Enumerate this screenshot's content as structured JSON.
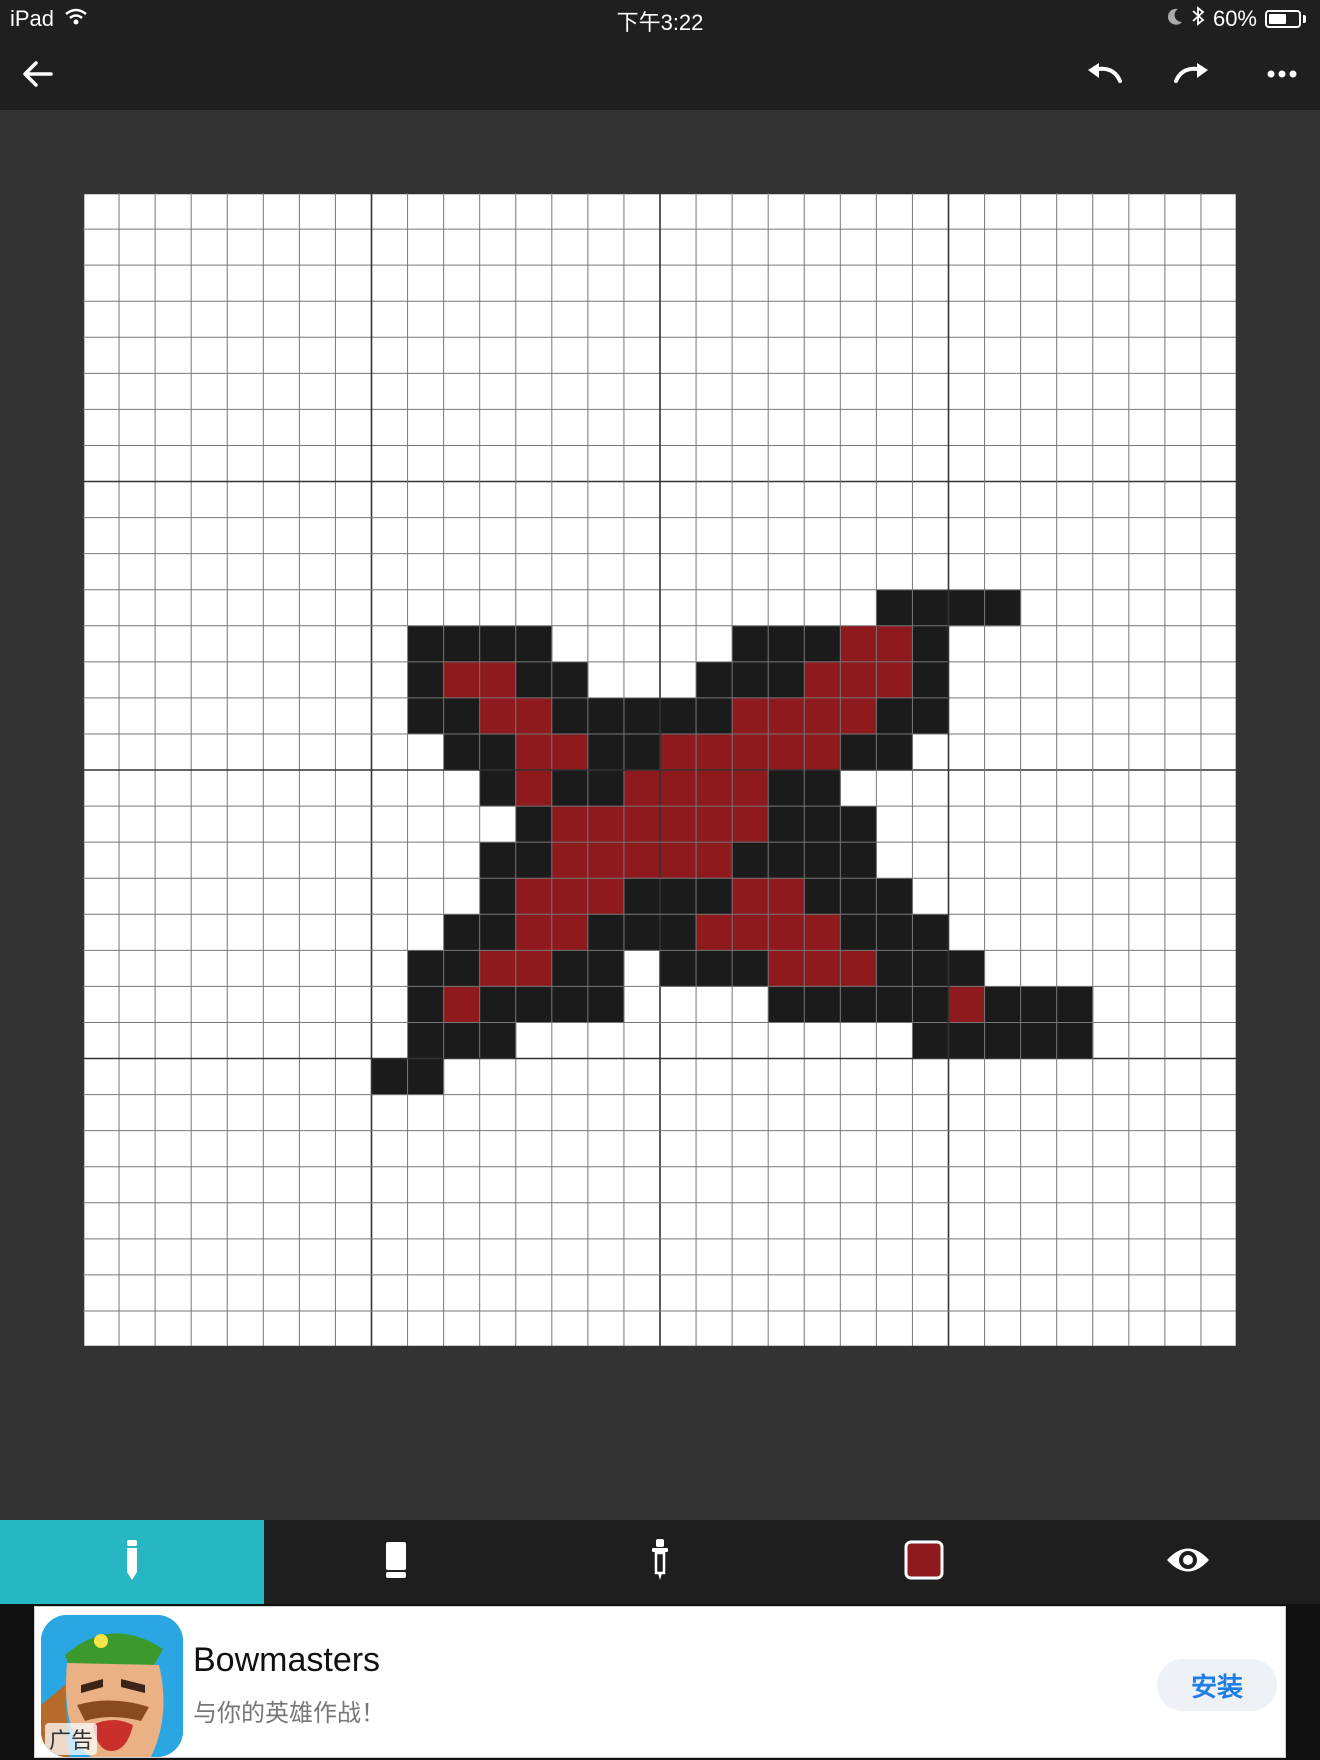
{
  "status": {
    "device": "iPad",
    "time": "下午3:22",
    "battery_text": "60%",
    "battery_level": 0.6,
    "icons": [
      "wifi-icon",
      "moon-icon",
      "bluetooth-icon",
      "battery-icon"
    ]
  },
  "toolbar": {
    "buttons": [
      "back-arrow-icon",
      "undo-icon",
      "redo-icon",
      "more-dots-icon"
    ]
  },
  "canvas": {
    "cols": 32,
    "rows": 32,
    "major_every": 8,
    "colors": {
      "K": "#1b1b1b",
      "R": "#8e1a1e",
      "background": "#ffffff",
      "grid": "#777777",
      "major_grid": "#333333"
    },
    "pixels": [
      "................................",
      "................................",
      "................................",
      "................................",
      "................................",
      "................................",
      "................................",
      "................................",
      "................................",
      "................................",
      "................................",
      "......................KKKK......",
      ".........KKKK.....KKKRRK........",
      ".........KRRKK...KKKRRRK........",
      ".........KKRRKKKKKRRRRKK........",
      "..........KKRRKKRRRRRKK.........",
      "...........KRKKRRRRKK...........",
      "............KRRRRRRKKK..........",
      "...........KKRRRRRKKKK..........",
      "...........KRRRKKKRRKKK.........",
      "..........KKRRKKKRRRRKKK........",
      ".........KKRRKK.KKKRRRKKK.......",
      ".........KRKKKK....KKKKKRKKK....",
      ".........KKK...........KKKKK....",
      "........KK......................",
      "................................",
      "................................",
      "................................",
      "................................",
      "................................",
      "................................",
      "................................"
    ]
  },
  "tools": [
    {
      "name": "pencil-tool",
      "icon": "pencil-icon",
      "active": true
    },
    {
      "name": "eraser-tool",
      "icon": "eraser-icon",
      "active": false
    },
    {
      "name": "eyedropper-tool",
      "icon": "eyedropper-icon",
      "active": false
    },
    {
      "name": "color-tool",
      "icon": "color-swatch-icon",
      "active": false,
      "color": "#8e1a1e"
    },
    {
      "name": "preview-tool",
      "icon": "eye-icon",
      "active": false
    }
  ],
  "ad": {
    "badge": "广告",
    "title": "Bowmasters",
    "subtitle": "与你的英雄作战！",
    "install": "安装"
  }
}
